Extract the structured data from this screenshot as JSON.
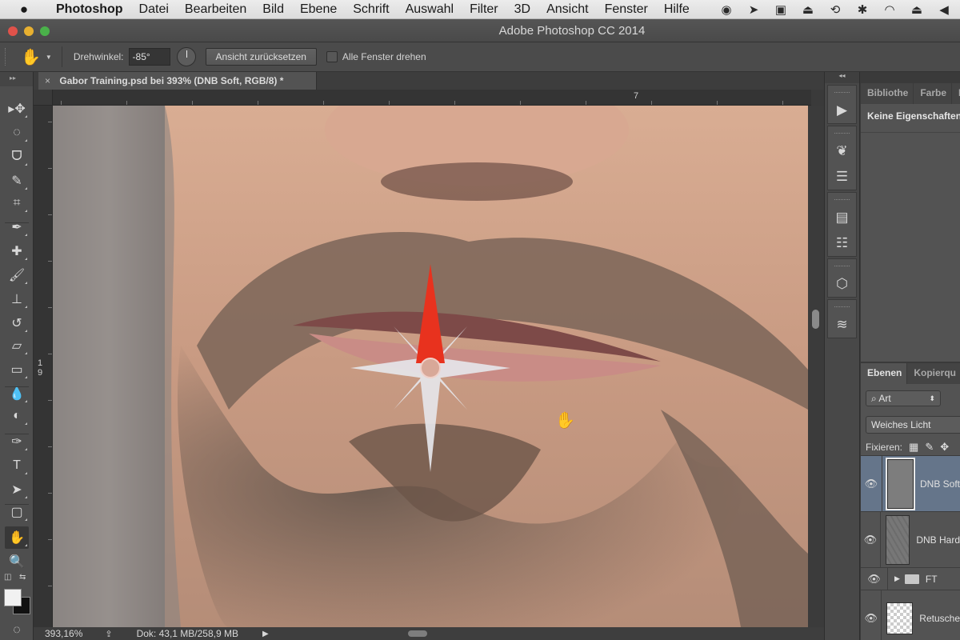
{
  "menubar": {
    "apple_icon": "apple-icon",
    "items": [
      "Photoshop",
      "Datei",
      "Bearbeiten",
      "Bild",
      "Ebene",
      "Schrift",
      "Auswahl",
      "Filter",
      "3D",
      "Ansicht",
      "Fenster",
      "Hilfe"
    ],
    "status_icons": [
      "record-icon",
      "arrow-icon",
      "display-icon",
      "airplay-icon",
      "time-machine-icon",
      "bluetooth-icon",
      "wifi-icon",
      "eject-icon",
      "volume-icon"
    ]
  },
  "window": {
    "title": "Adobe Photoshop CC 2014"
  },
  "options": {
    "tool_icon": "rotate-view-icon",
    "angle_label": "Drehwinkel:",
    "angle_value": "-85°",
    "reset_label": "Ansicht zurücksetzen",
    "rotate_all_label": "Alle Fenster drehen",
    "rotate_all_checked": false
  },
  "document": {
    "tab_title": "Gabor Training.psd bei 393% (DNB Soft, RGB/8) *",
    "ruler_h_label": "7",
    "ruler_v_label_1": "1",
    "ruler_v_label_2": "9",
    "rotation_degrees": -85
  },
  "status": {
    "zoom": "393,16%",
    "doc_size": "Dok: 43,1 MB/258,9 MB"
  },
  "tools": [
    {
      "name": "move-tool",
      "glyph": "▸✥"
    },
    {
      "name": "elliptical-marquee-tool",
      "glyph": "◌"
    },
    {
      "name": "lasso-tool",
      "glyph": "ᗜ"
    },
    {
      "name": "quick-selection-tool",
      "glyph": "✎"
    },
    {
      "name": "crop-tool",
      "glyph": "⌗"
    },
    {
      "name": "eyedropper-tool",
      "glyph": "✒"
    },
    {
      "name": "healing-brush-tool",
      "glyph": "✚"
    },
    {
      "name": "brush-tool",
      "glyph": "🖌"
    },
    {
      "name": "clone-stamp-tool",
      "glyph": "⊥"
    },
    {
      "name": "history-brush-tool",
      "glyph": "↺"
    },
    {
      "name": "eraser-tool",
      "glyph": "▱"
    },
    {
      "name": "gradient-tool",
      "glyph": "▭"
    },
    {
      "name": "blur-tool",
      "glyph": "💧"
    },
    {
      "name": "dodge-tool",
      "glyph": "◐"
    },
    {
      "name": "pen-tool",
      "glyph": "✑"
    },
    {
      "name": "type-tool",
      "glyph": "T"
    },
    {
      "name": "path-selection-tool",
      "glyph": "➤"
    },
    {
      "name": "rectangle-tool",
      "glyph": "▢"
    },
    {
      "name": "rotate-view-tool",
      "glyph": "✋"
    },
    {
      "name": "zoom-tool",
      "glyph": "🔍"
    }
  ],
  "colors": {
    "foreground": "#f1f1f1",
    "background": "#111111",
    "compass_north": "#e8321e",
    "compass_body": "#e6e6ea",
    "selected_layer": "#65758a"
  },
  "dock": {
    "buttons": [
      "play-icon",
      "brushes-icon",
      "brush-settings-icon",
      "properties-icon",
      "notes-icon",
      "3d-icon",
      "layers-icon"
    ]
  },
  "properties_panel": {
    "tabs": [
      "Bibliothe",
      "Farbe",
      "Far"
    ],
    "content": "Keine Eigenschaften"
  },
  "layers_panel": {
    "tabs": [
      "Ebenen",
      "Kopierqu"
    ],
    "filter": "Art",
    "blend_mode": "Weiches Licht",
    "lock_label": "Fixieren:",
    "layers": [
      {
        "name": "DNB Soft",
        "visible": true,
        "selected": true,
        "type": "pixel"
      },
      {
        "name": "DNB Hard",
        "visible": true,
        "selected": false,
        "type": "pixel"
      },
      {
        "name": "FT",
        "visible": true,
        "selected": false,
        "type": "group"
      },
      {
        "name": "Retusche",
        "visible": true,
        "selected": false,
        "type": "transparent"
      }
    ]
  }
}
